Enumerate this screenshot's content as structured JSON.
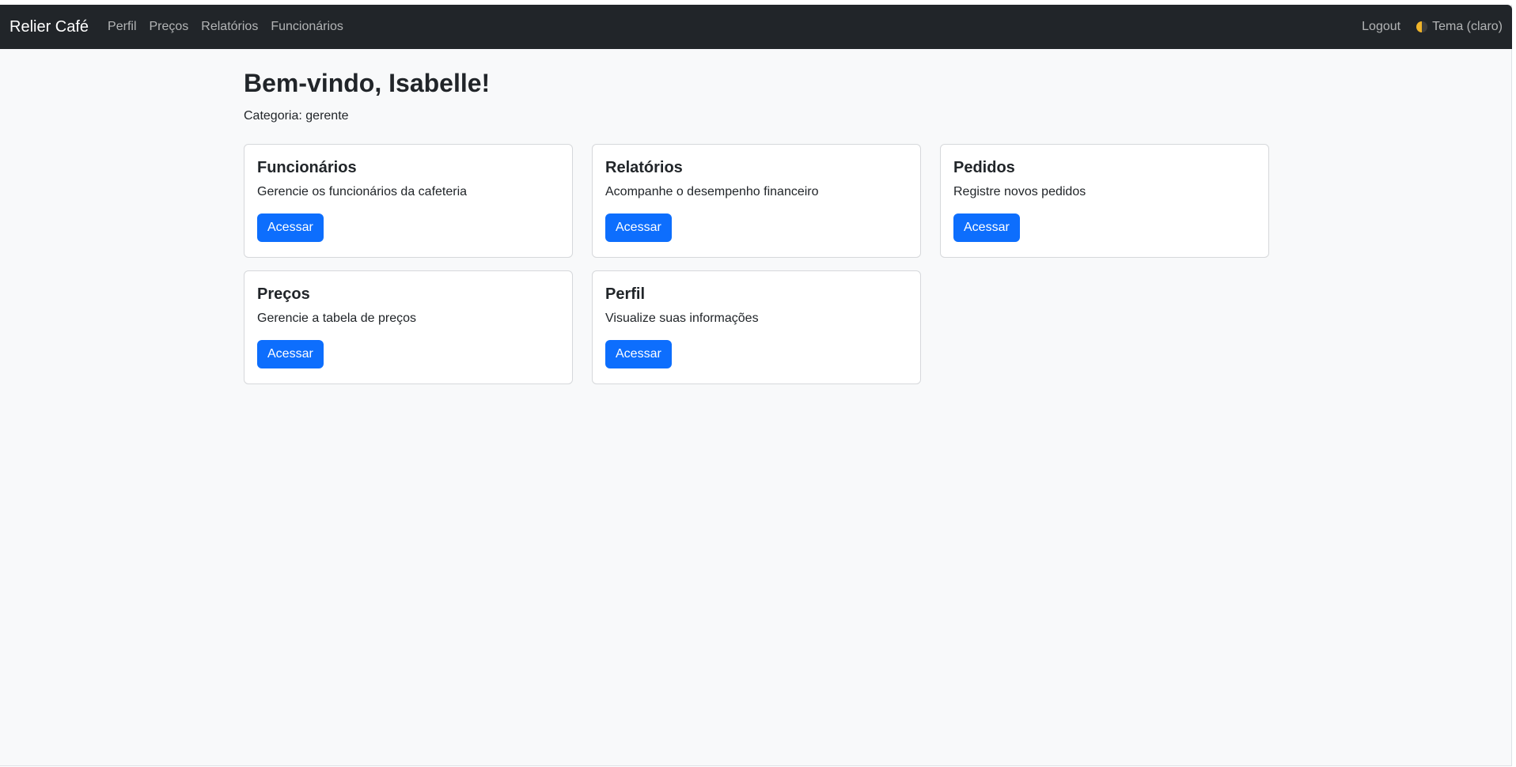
{
  "navbar": {
    "brand": "Relier Café",
    "links": [
      "Perfil",
      "Preços",
      "Relatórios",
      "Funcionários"
    ],
    "logout": "Logout",
    "theme_label": "Tema (claro)"
  },
  "main": {
    "welcome": "Bem-vindo, Isabelle!",
    "category_label": "Categoria:",
    "category_value": "gerente"
  },
  "cards": [
    {
      "title": "Funcionários",
      "text": "Gerencie os funcionários da cafeteria",
      "button": "Acessar"
    },
    {
      "title": "Relatórios",
      "text": "Acompanhe o desempenho financeiro",
      "button": "Acessar"
    },
    {
      "title": "Pedidos",
      "text": "Registre novos pedidos",
      "button": "Acessar"
    },
    {
      "title": "Preços",
      "text": "Gerencie a tabela de preços",
      "button": "Acessar"
    },
    {
      "title": "Perfil",
      "text": "Visualize suas informações",
      "button": "Acessar"
    }
  ],
  "colors": {
    "navbar_bg": "#212529",
    "page_bg": "#f8f9fa",
    "primary": "#0d6efd"
  },
  "icons": {
    "theme": "half-circle-theme-icon"
  }
}
